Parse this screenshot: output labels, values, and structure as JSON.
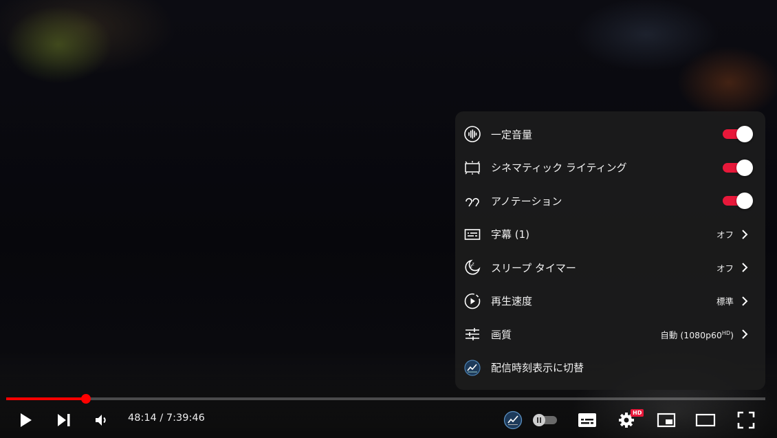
{
  "settings": {
    "items": [
      {
        "label": "一定音量",
        "type": "toggle",
        "on": true,
        "icon": "stable-volume-icon"
      },
      {
        "label": "シネマティック ライティング",
        "type": "toggle",
        "on": true,
        "icon": "ambient-mode-icon"
      },
      {
        "label": "アノテーション",
        "type": "toggle",
        "on": true,
        "icon": "annotations-icon"
      },
      {
        "label": "字幕 (1)",
        "type": "submenu",
        "value": "オフ",
        "icon": "subtitles-icon"
      },
      {
        "label": "スリープ タイマー",
        "type": "submenu",
        "value": "オフ",
        "icon": "sleep-timer-icon"
      },
      {
        "label": "再生速度",
        "type": "submenu",
        "value": "標準",
        "icon": "playback-speed-icon"
      },
      {
        "label": "画質",
        "type": "submenu",
        "value": "自動 (1080p60",
        "value_sup": "HD",
        "value_end": ")",
        "icon": "quality-icon"
      },
      {
        "label": "配信時刻表示に切替",
        "type": "action",
        "icon": "stats-chart-icon"
      }
    ]
  },
  "player": {
    "time_current": "48:14",
    "time_separator": " / ",
    "time_total": "7:39:46",
    "progress_fraction": 0.1048,
    "hd_badge": "HD",
    "accent_color": "#ff0000",
    "toggle_color": "#e8183a"
  }
}
